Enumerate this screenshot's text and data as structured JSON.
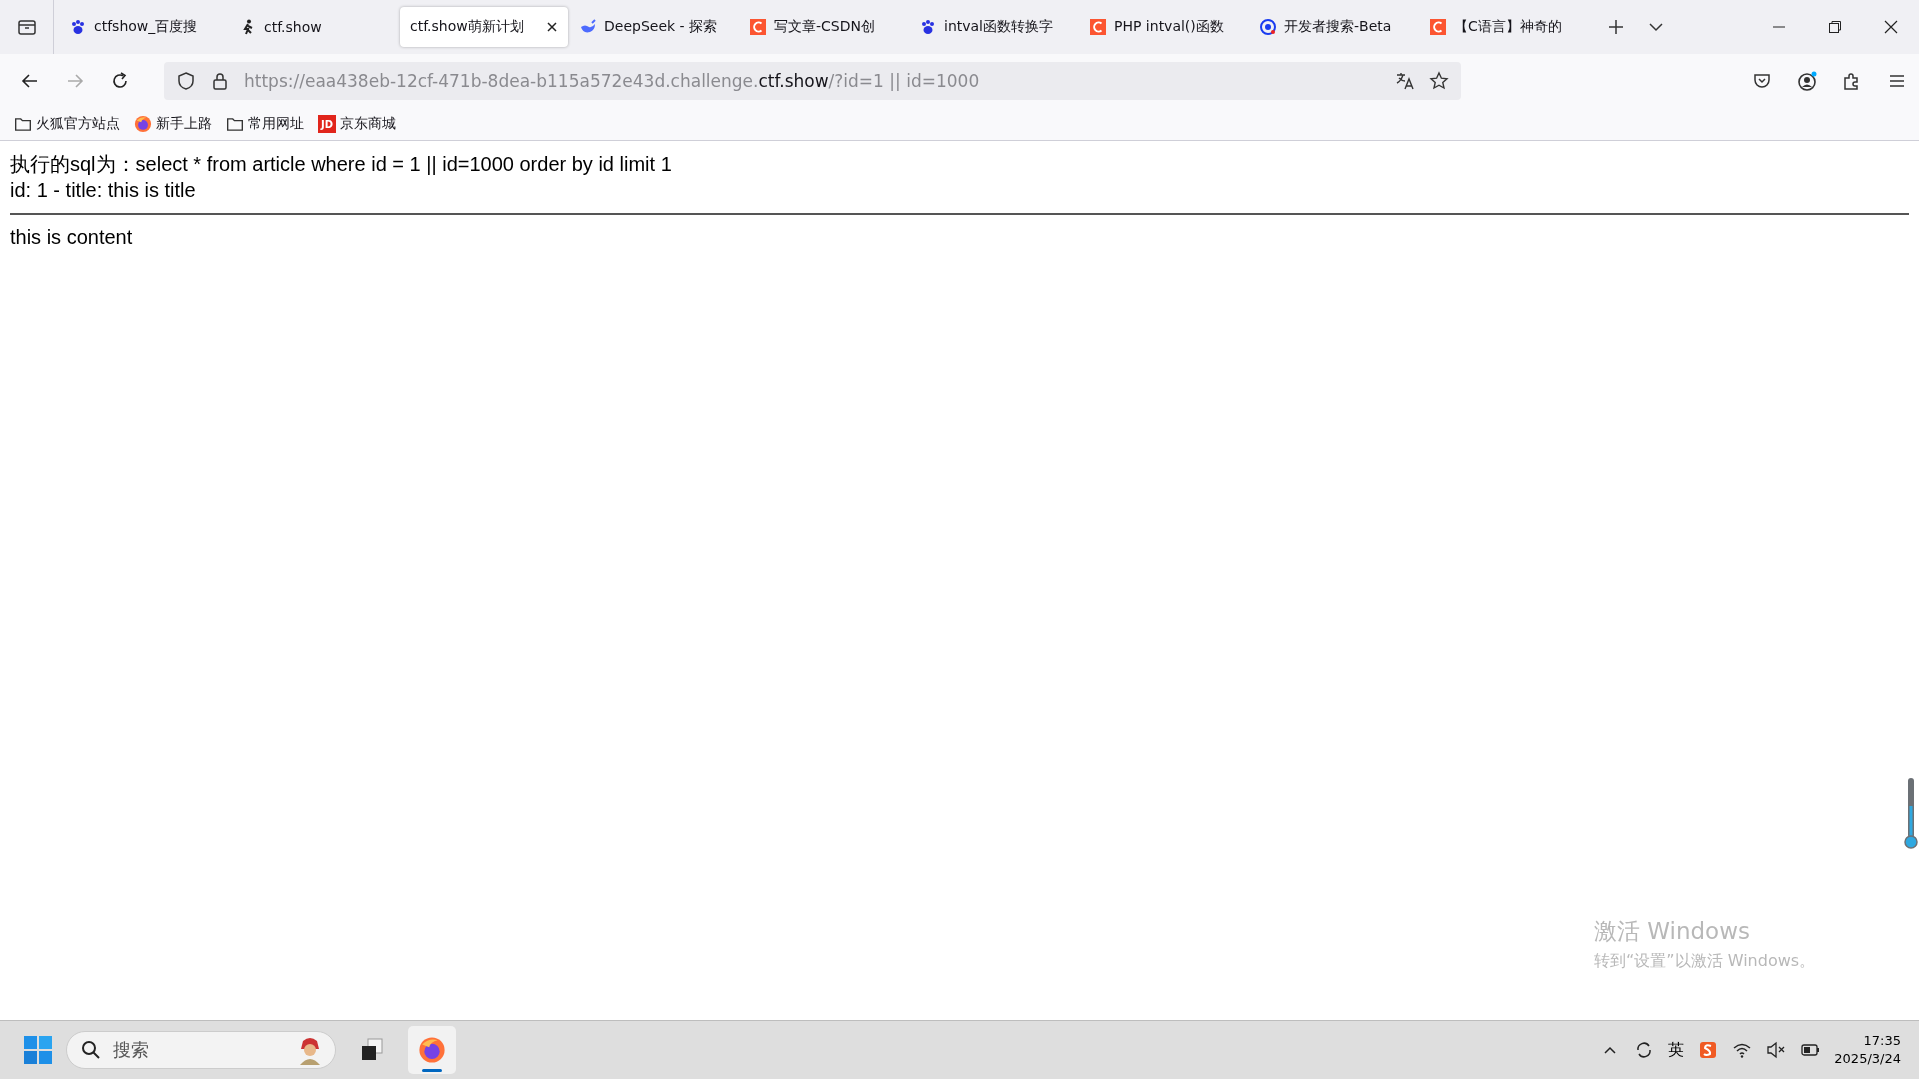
{
  "tabs": [
    {
      "title": "ctfshow_百度搜",
      "kind": "paw",
      "selected": false
    },
    {
      "title": "ctf.show",
      "kind": "figure",
      "selected": false
    },
    {
      "title": "ctf.show萌新计划",
      "kind": "none",
      "selected": true
    },
    {
      "title": "DeepSeek - 探索",
      "kind": "whale",
      "selected": false
    },
    {
      "title": "写文章-CSDN创",
      "kind": "c-logo",
      "selected": false
    },
    {
      "title": "intval函数转换字",
      "kind": "paw",
      "selected": false
    },
    {
      "title": "PHP intval()函数",
      "kind": "c-logo",
      "selected": false
    },
    {
      "title": "开发者搜索-Beta",
      "kind": "target",
      "selected": false
    },
    {
      "title": "【C语言】神奇的",
      "kind": "c-logo",
      "selected": false
    }
  ],
  "address": {
    "prefix": "https://eaa438eb-12cf-471b-8dea-b115a572e43d.challenge.",
    "domain": "ctf.show",
    "suffix": "/?id=1 || id=1000"
  },
  "bookmarks": [
    {
      "label": "火狐官方站点",
      "kind": "folder"
    },
    {
      "label": "新手上路",
      "kind": "firefox"
    },
    {
      "label": "常用网址",
      "kind": "folder"
    },
    {
      "label": "京东商城",
      "kind": "jd",
      "logo_text": "JD"
    }
  ],
  "page": {
    "sql_line": "执行的sql为：select * from article where id = 1 || id=1000 order by id limit 1",
    "title_line": "id: 1 - title: this is title",
    "content": "this is content"
  },
  "activation_notice": {
    "title": "激活 Windows",
    "subtitle": "转到“设置”以激活 Windows。"
  },
  "taskbar": {
    "search_placeholder": "搜索",
    "apps": [
      {
        "kind": "task-view",
        "selected": false
      },
      {
        "kind": "firefox",
        "selected": true
      }
    ],
    "ime": "英",
    "time": "17:35",
    "date": "2025/3/24"
  }
}
